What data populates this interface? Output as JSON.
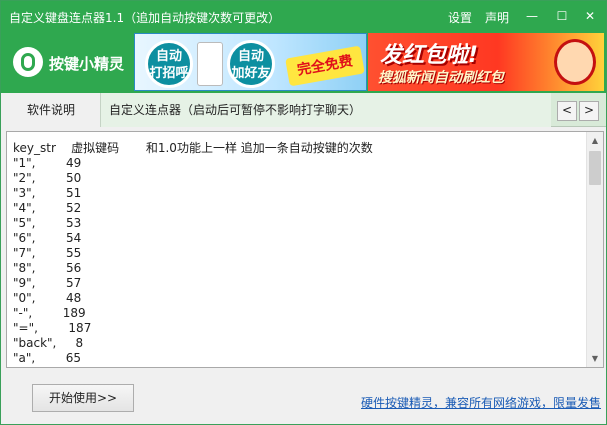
{
  "window": {
    "title": "自定义键盘连点器1.1（追加自动按键次数可更改）",
    "settings_label": "设置",
    "statement_label": "声明",
    "minimize_glyph": "—",
    "maximize_glyph": "☐",
    "close_glyph": "✕"
  },
  "banner": {
    "logo_text": "按键小精灵",
    "ad1": {
      "circle1": "自动\n打招呼",
      "circle2": "自动\n加好友",
      "badge": "完全免费"
    },
    "ad2": {
      "headline": "发红包啦!",
      "subline": "搜狐新闻自动刷红包"
    }
  },
  "tabs": {
    "tab1": "软件说明",
    "tab2": "自定义连点器（启动后可暂停不影响打字聊天）",
    "prev_glyph": "<",
    "next_glyph": ">"
  },
  "content": {
    "text": "key_str    虚拟键码       和1.0功能上一样 追加一条自动按键的次数\n\"1\",        49\n\"2\",        50\n\"3\",        51\n\"4\",        52\n\"5\",        53\n\"6\",        54\n\"7\",        55\n\"8\",        56\n\"9\",        57\n\"0\",        48\n\"-\",        189\n\"=\",        187\n\"back\",     8\n\"a\",        65",
    "scroll_up": "▲",
    "scroll_down": "▼"
  },
  "footer": {
    "start_button": "开始使用>>",
    "link": "硬件按键精灵，兼容所有网络游戏，限量发售"
  },
  "colors": {
    "titlebar": "#2fa84f",
    "tab_strip": "#d8ead8",
    "link": "#1a5bb5"
  }
}
